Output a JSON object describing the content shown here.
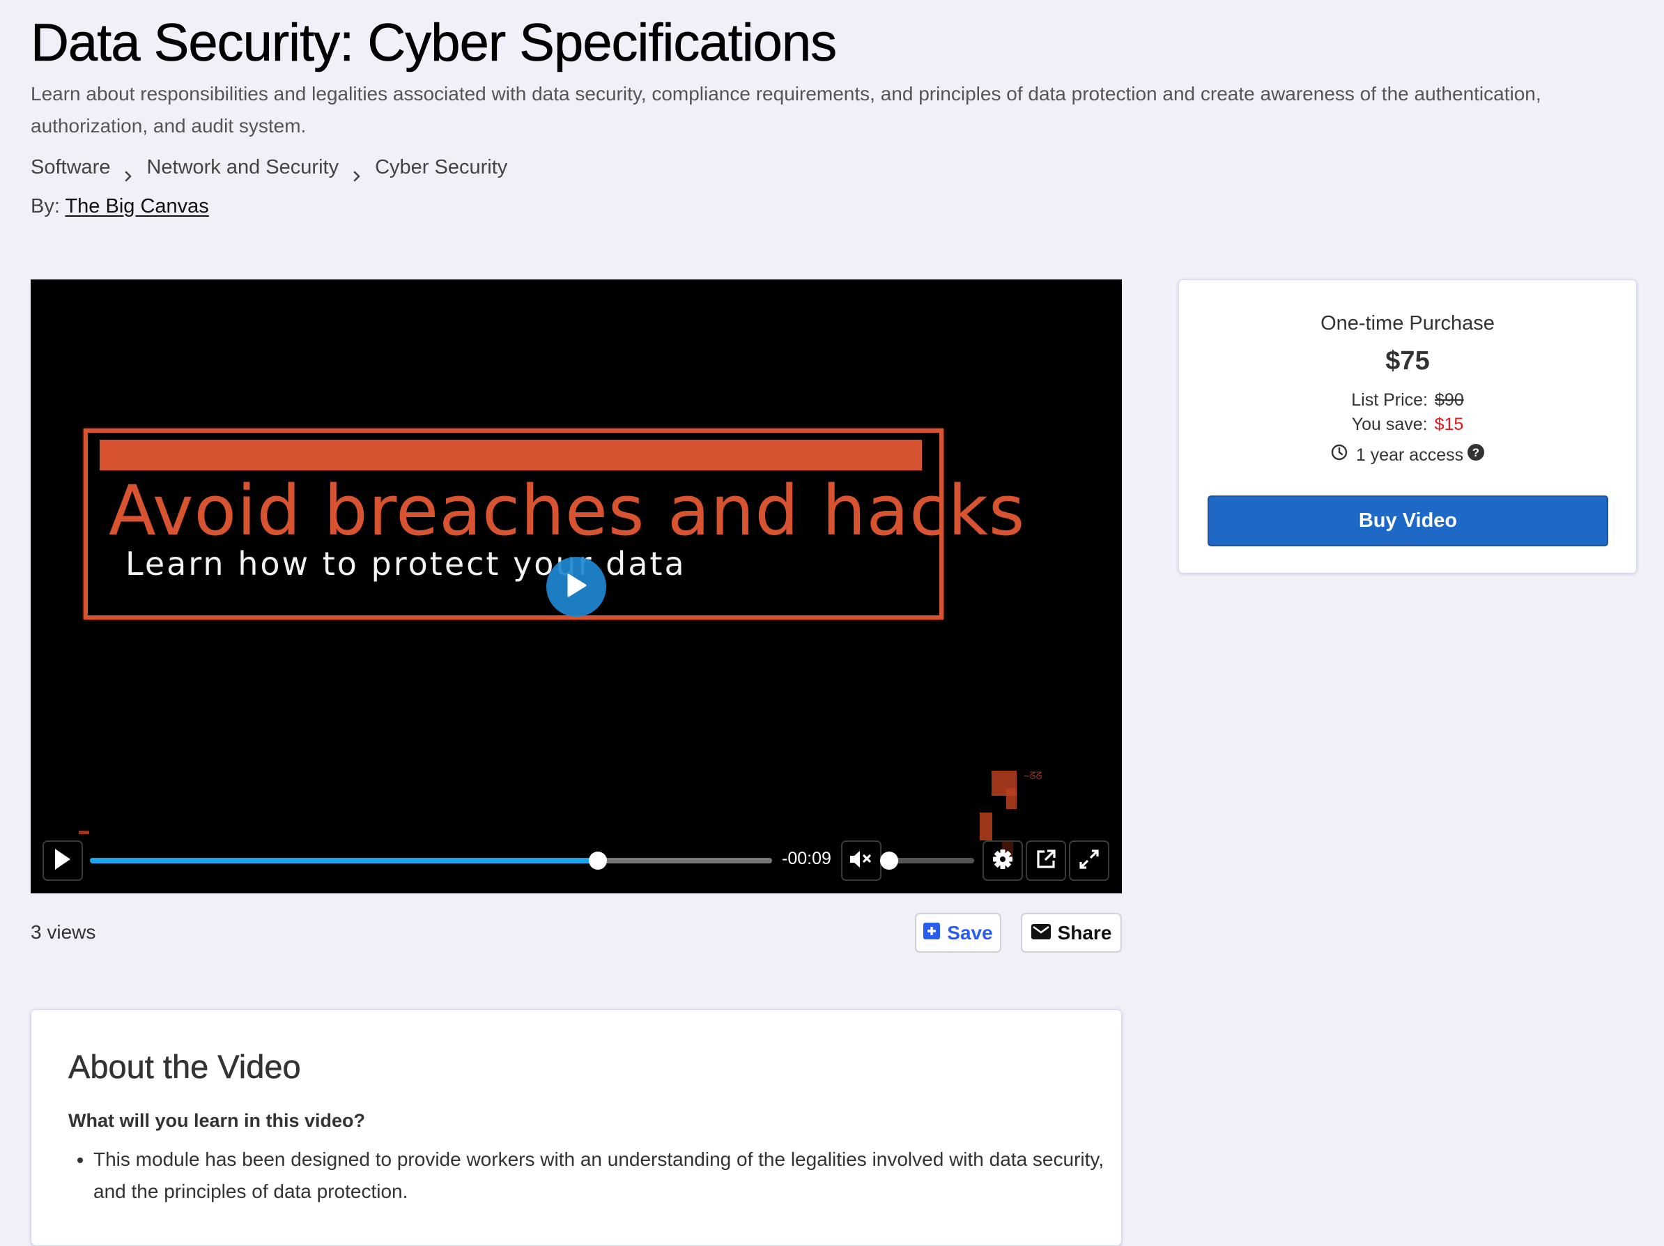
{
  "header": {
    "title": "Data Security: Cyber Specifications",
    "description": "Learn about responsibilities and legalities associated with data security, compliance requirements, and principles of data protection and create awareness of the authentication, authorization, and audit system.",
    "breadcrumb": [
      "Software",
      "Network and Security",
      "Cyber Security"
    ],
    "by_label": "By:",
    "author": "The Big Canvas"
  },
  "video": {
    "frame_title": "Avoid breaches and hacks",
    "frame_subtitle": "Learn how to protect your data",
    "time_remaining": "-00:09",
    "progress": 0.745,
    "volume": 0,
    "muted": true,
    "controls": {
      "play_icon": "play-icon",
      "mute_icon": "volume-mute-icon",
      "settings_icon": "gear-icon",
      "popout_icon": "external-link-icon",
      "fullscreen_icon": "expand-icon"
    },
    "accent_color": "#1DA6F0",
    "frame_color": "#D8532F"
  },
  "stats": {
    "views": "3 views"
  },
  "actions": {
    "save_label": "Save",
    "share_label": "Share",
    "save_color": "#2B5CF0"
  },
  "purchase": {
    "type": "One-time Purchase",
    "price": "$75",
    "list_price_label": "List Price:",
    "list_price": "$90",
    "you_save_label": "You save:",
    "you_save": "$15",
    "you_save_color": "#E8161C",
    "access": "1 year access",
    "buy_label": "Buy Video",
    "buy_color": "#1F69C6"
  },
  "about": {
    "title": "About the Video",
    "subtitle": "What will you learn in this video?",
    "bullets": [
      "This module has been designed to provide workers with an understanding of the legalities involved with data security, and the principles of data protection."
    ]
  }
}
